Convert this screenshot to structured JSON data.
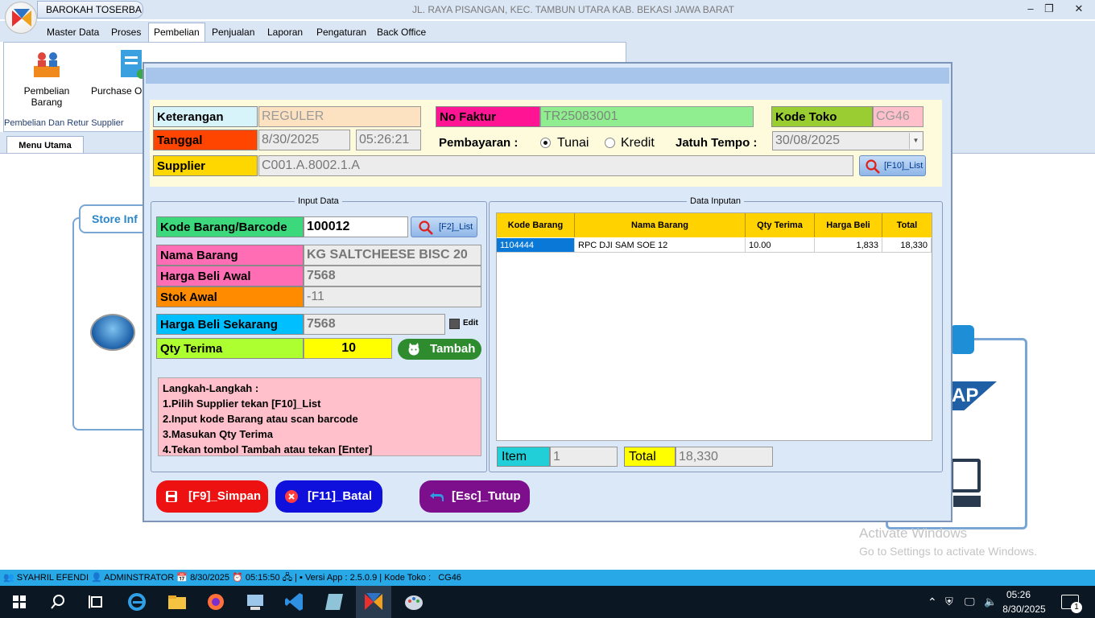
{
  "app": {
    "name": "BAROKAH  TOSERBA",
    "title": "JL. RAYA PISANGAN, KEC. TAMBUN UTARA KAB. BEKASI JAWA BARAT",
    "window_controls": [
      "–",
      "❐",
      "✕"
    ]
  },
  "menu": [
    "Master Data",
    "Proses",
    "Pembelian",
    "Penjualan",
    "Laporan",
    "Pengaturan",
    "Back Office"
  ],
  "ribbon": {
    "buttons": [
      "Pembelian Barang",
      "Purchase Or"
    ],
    "group_label": "Pembelian Dan Retur Supplier"
  },
  "tabs": [
    "Menu Utama"
  ],
  "background": {
    "store_info_tab": "Store Inf",
    "sap_text": "AP",
    "activate_line1": "Activate Windows",
    "activate_line2": "Go to Settings to activate Windows."
  },
  "header": {
    "keterangan_label": "Keterangan",
    "keterangan_value": "REGULER",
    "no_faktur_label": "No Faktur",
    "no_faktur_value": "TR25083001",
    "kode_toko_label": "Kode Toko",
    "kode_toko_value": "CG46",
    "tanggal_label": "Tanggal",
    "tanggal_value": "8/30/2025",
    "time_value": "05:26:21",
    "pembayaran_label": "Pembayaran :",
    "option_tunai": "Tunai",
    "option_kredit": "Kredit",
    "selected_payment": "Tunai",
    "jatuh_tempo_label": "Jatuh Tempo :",
    "jatuh_tempo_value": "30/08/2025",
    "supplier_label": "Supplier",
    "supplier_value": "C001.A.8002.1.A",
    "supplier_list_button": "[F10]_List"
  },
  "input_data": {
    "title": "Input Data",
    "kode_label": "Kode Barang/Barcode",
    "kode_value": "100012",
    "kode_list_button": "[F2]_List",
    "nama_label": "Nama Barang",
    "nama_value": "KG SALTCHEESE BISC 20",
    "harga_awal_label": "Harga Beli Awal",
    "harga_awal_value": "7568",
    "stok_label": "Stok Awal",
    "stok_value": "-11",
    "harga_sekarang_label": "Harga Beli Sekarang",
    "harga_sekarang_value": "7568",
    "edit_label": "Edit",
    "qty_label": "Qty Terima",
    "qty_value": "10",
    "tambah_button": "Tambah"
  },
  "steps": {
    "title": "Langkah-Langkah :",
    "lines": [
      "1.Pilih Supplier tekan [F10]_List",
      "2.Input kode Barang atau scan barcode",
      "3.Masukan Qty Terima",
      "4.Tekan tombol Tambah atau tekan [Enter]"
    ]
  },
  "data_inputan": {
    "title": "Data Inputan",
    "columns": [
      "Kode Barang",
      "Nama Barang",
      "Qty Terima",
      "Harga Beli",
      "Total"
    ],
    "rows": [
      [
        "1104444",
        "RPC DJI SAM SOE 12",
        "10.00",
        "1,833",
        "18,330"
      ]
    ],
    "item_label": "Item",
    "item_value": "1",
    "total_label": "Total",
    "total_value": "18,330"
  },
  "actions": {
    "simpan": "[F9]_Simpan",
    "batal": "[F11]_Batal",
    "tutup": "[Esc]_Tutup"
  },
  "statusbar": {
    "user": "SYAHRIL EFENDI",
    "role": "ADMINSTRATOR",
    "date": "8/30/2025",
    "time": "05:15:50",
    "versi": "Versi App : 2.5.0.9",
    "kode_toko_label": "Kode Toko :",
    "kode_toko_value": "CG46"
  },
  "taskbar": {
    "time": "05:26",
    "date": "8/30/2025",
    "notification_count": "1"
  },
  "colors": {
    "accent_blue": "#29a8e8",
    "label_cyan": "#d8f4fb",
    "label_magenta": "#ff1493",
    "label_green": "#9acd32",
    "label_orange_red": "#ff4500",
    "label_gold": "#ffd700",
    "grid_header": "#ffd200",
    "simpan_red": "#ee1111",
    "batal_blue": "#1010dd",
    "tutup_purple": "#7d0f8c"
  }
}
